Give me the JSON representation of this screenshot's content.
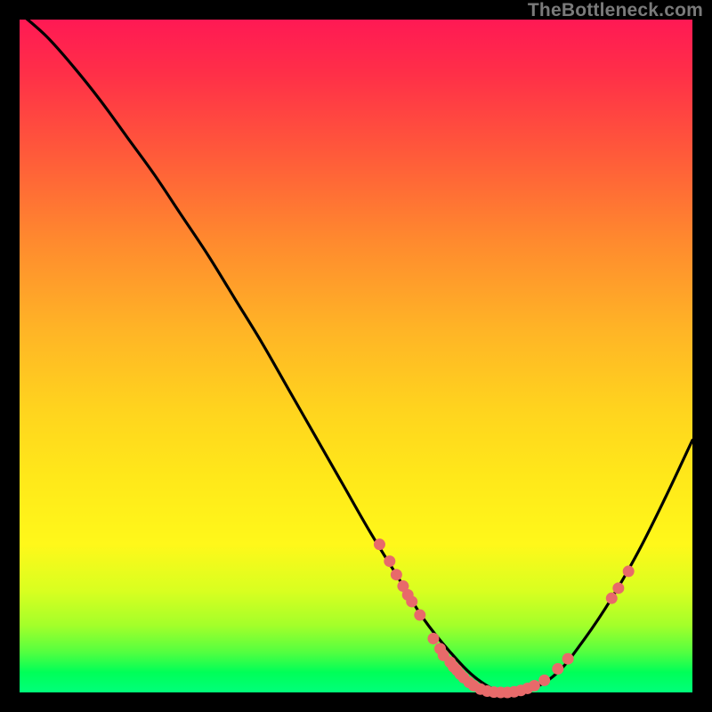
{
  "attribution": "TheBottleneck.com",
  "chart_data": {
    "type": "line",
    "title": "",
    "xlabel": "",
    "ylabel": "",
    "xlim": [
      0,
      100
    ],
    "ylim": [
      0,
      100
    ],
    "x": [
      0,
      4,
      8,
      12,
      16,
      20,
      24,
      28,
      32,
      36,
      40,
      44,
      48,
      52,
      56,
      60,
      64,
      68,
      72,
      76,
      80,
      84,
      88,
      92,
      96,
      100
    ],
    "values": [
      101,
      97.5,
      93,
      88,
      82.5,
      77,
      71,
      65,
      58.5,
      52,
      45,
      38,
      31,
      24,
      17.5,
      11,
      6,
      2,
      0,
      0.5,
      3,
      8,
      14,
      21,
      29,
      37.5
    ],
    "series": [
      {
        "name": "curve",
        "x": [
          0,
          4,
          8,
          12,
          16,
          20,
          24,
          28,
          32,
          36,
          40,
          44,
          48,
          52,
          56,
          60,
          64,
          68,
          72,
          76,
          80,
          84,
          88,
          92,
          96,
          100
        ],
        "y": [
          101,
          97.5,
          93,
          88,
          82.5,
          77,
          71,
          65,
          58.5,
          52,
          45,
          38,
          31,
          24,
          17.5,
          11,
          6,
          2,
          0,
          0.5,
          3,
          8,
          14,
          21,
          29,
          37.5
        ]
      }
    ],
    "markers": [
      {
        "x": 53.5,
        "y": 22
      },
      {
        "x": 55.0,
        "y": 19.5
      },
      {
        "x": 56.0,
        "y": 17.5
      },
      {
        "x": 57.0,
        "y": 15.8
      },
      {
        "x": 57.7,
        "y": 14.5
      },
      {
        "x": 58.3,
        "y": 13.5
      },
      {
        "x": 59.5,
        "y": 11.5
      },
      {
        "x": 61.5,
        "y": 8
      },
      {
        "x": 62.5,
        "y": 6.5
      },
      {
        "x": 63.0,
        "y": 5.5
      },
      {
        "x": 64.0,
        "y": 4.5
      },
      {
        "x": 64.5,
        "y": 3.8
      },
      {
        "x": 65.0,
        "y": 3.3
      },
      {
        "x": 65.5,
        "y": 2.7
      },
      {
        "x": 66.0,
        "y": 2.2
      },
      {
        "x": 66.8,
        "y": 1.5
      },
      {
        "x": 67.5,
        "y": 1.0
      },
      {
        "x": 68.5,
        "y": 0.5
      },
      {
        "x": 69.5,
        "y": 0.2
      },
      {
        "x": 70.5,
        "y": 0.05
      },
      {
        "x": 71.5,
        "y": 0.0
      },
      {
        "x": 72.5,
        "y": 0.0
      },
      {
        "x": 73.5,
        "y": 0.1
      },
      {
        "x": 74.5,
        "y": 0.3
      },
      {
        "x": 75.5,
        "y": 0.6
      },
      {
        "x": 76.5,
        "y": 1.0
      },
      {
        "x": 78.0,
        "y": 1.8
      },
      {
        "x": 80.0,
        "y": 3.5
      },
      {
        "x": 81.5,
        "y": 5.0
      },
      {
        "x": 88.0,
        "y": 14.0
      },
      {
        "x": 89.0,
        "y": 15.5
      },
      {
        "x": 90.5,
        "y": 18.0
      }
    ],
    "marker_color": "#e86a6a",
    "line_color": "#000000"
  }
}
